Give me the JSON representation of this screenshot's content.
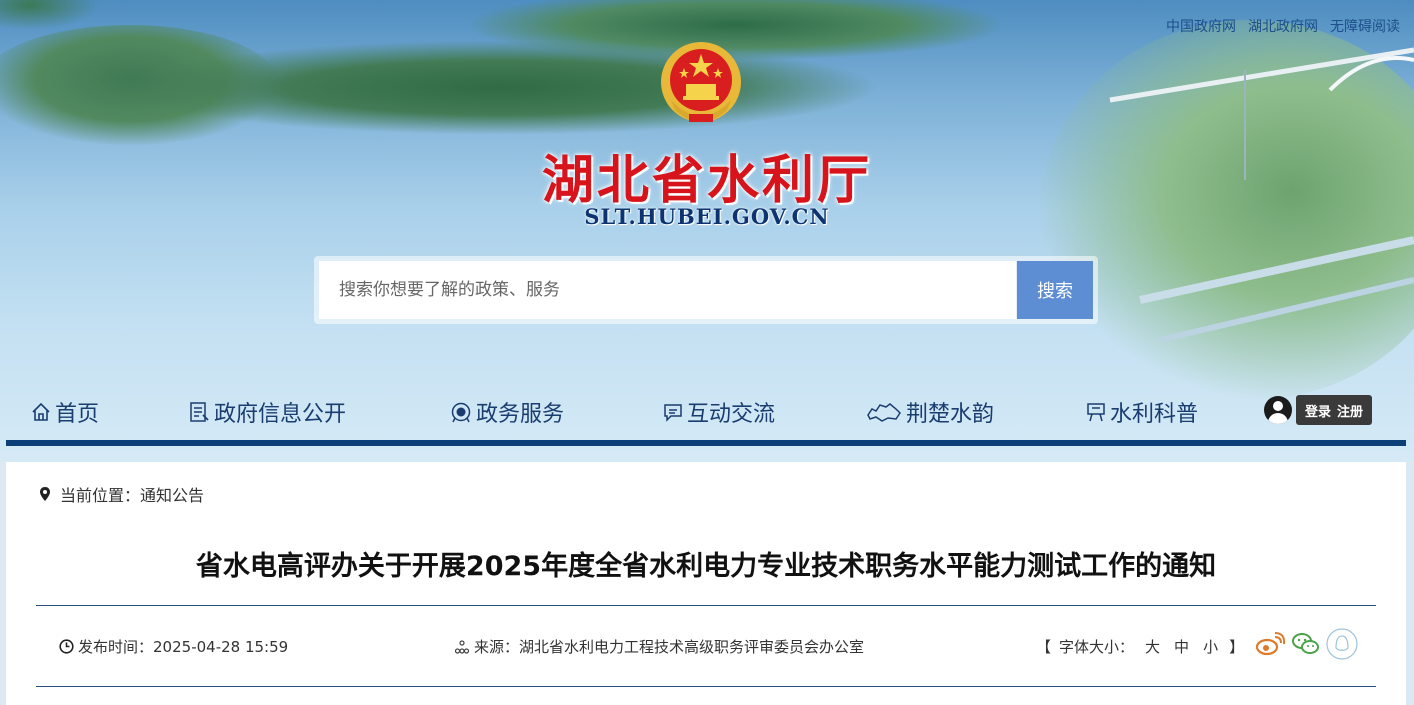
{
  "top_links": [
    "中国政府网",
    "湖北政府网",
    "无障碍阅读"
  ],
  "site": {
    "title": "湖北省水利厅",
    "domain": "SLT.HUBEI.GOV.CN"
  },
  "search": {
    "placeholder": "搜索你想要了解的政策、服务",
    "button": "搜索"
  },
  "nav": [
    {
      "label": "首页",
      "icon": "home-icon"
    },
    {
      "label": "政府信息公开",
      "icon": "document-list-icon"
    },
    {
      "label": "政务服务",
      "icon": "service-badge-icon"
    },
    {
      "label": "互动交流",
      "icon": "chat-bubble-icon"
    },
    {
      "label": "荆楚水韵",
      "icon": "hubei-map-icon"
    },
    {
      "label": "水利科普",
      "icon": "signboard-icon"
    }
  ],
  "user": {
    "login": "登录",
    "register": "注册",
    "icon": "user-avatar-icon"
  },
  "breadcrumb": {
    "label": "当前位置：",
    "current": "通知公告",
    "icon": "location-pin-icon"
  },
  "article": {
    "title": "省水电高评办关于开展2025年度全省水利电力专业技术职务水平能力测试工作的通知",
    "publish_label": "发布时间：",
    "publish_time": "2025-04-28 15:59",
    "source_label": "来源：",
    "source": "湖北省水利电力工程技术高级职务评审委员会办公室"
  },
  "font_size": {
    "open": "【",
    "label": "字体大小：",
    "options": [
      "大",
      "中",
      "小"
    ],
    "close": "】"
  },
  "share": [
    "weibo-icon",
    "wechat-icon",
    "qq-icon"
  ],
  "colors": {
    "accent": "#0a3f78",
    "title_red": "#d7141b",
    "search_button": "#5d8ed3"
  }
}
